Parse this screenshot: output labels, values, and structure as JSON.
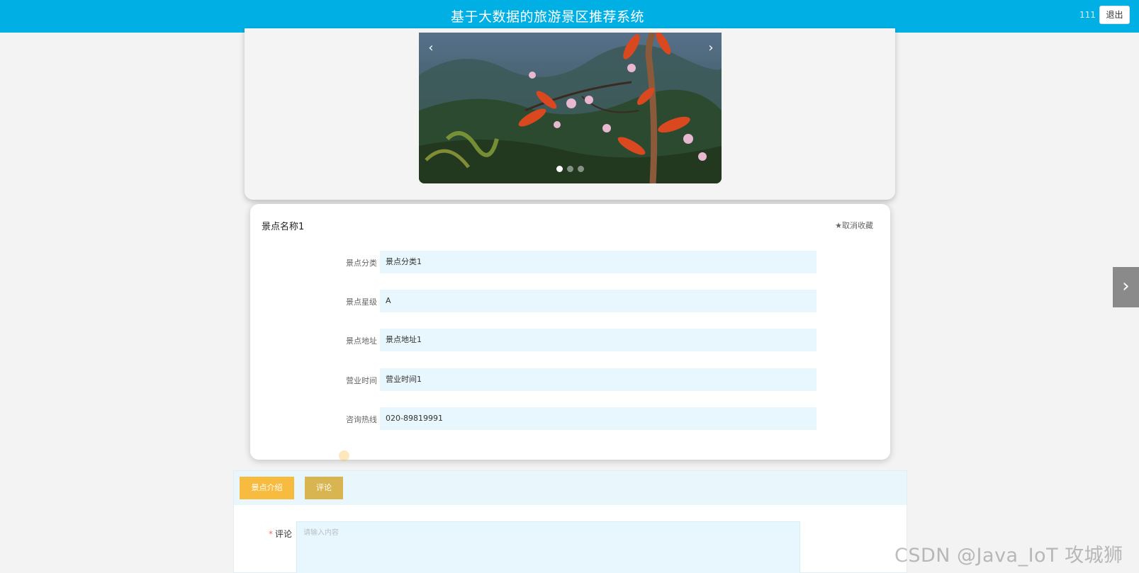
{
  "header": {
    "title": "基于大数据的旅游景区推荐系统",
    "username": "111",
    "logout_label": "退出"
  },
  "carousel": {
    "prev_label": "‹",
    "next_label": "›",
    "slide_count": 3,
    "active_index": 0
  },
  "detail": {
    "name": "景点名称1",
    "favorite_label": "★取消收藏",
    "fields": [
      {
        "label": "景点分类",
        "value": "景点分类1"
      },
      {
        "label": "景点星级",
        "value": "A"
      },
      {
        "label": "景点地址",
        "value": "景点地址1"
      },
      {
        "label": "营业时间",
        "value": "营业时间1"
      },
      {
        "label": "咨询热线",
        "value": "020-89819991"
      }
    ]
  },
  "tabs": [
    {
      "label": "景点介绍"
    },
    {
      "label": "评论"
    }
  ],
  "comment": {
    "required_mark": "*",
    "label": "评论",
    "placeholder": "请输入内容"
  },
  "side_nav": {
    "label": "›"
  },
  "watermark": "CSDN @Java_IoT 攻城狮",
  "colors": {
    "header_bg": "#00b0e4",
    "tab_active": "#f7bc3f",
    "tab_inactive": "#d8b550",
    "field_bg": "#e8f7fd"
  }
}
